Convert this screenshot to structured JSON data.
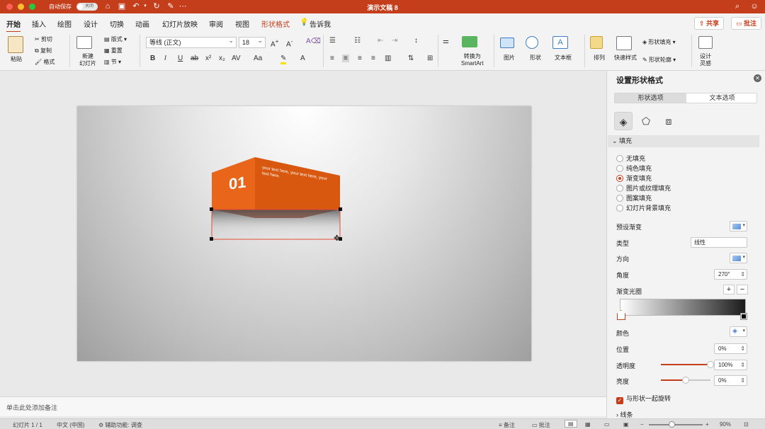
{
  "app": {
    "autosave_label": "自动保存",
    "autosave_state": "关闭",
    "doc_title": "演示文稿 8"
  },
  "tabs": [
    {
      "label": "开始"
    },
    {
      "label": "插入"
    },
    {
      "label": "绘图"
    },
    {
      "label": "设计"
    },
    {
      "label": "切换"
    },
    {
      "label": "动画"
    },
    {
      "label": "幻灯片放映"
    },
    {
      "label": "审阅"
    },
    {
      "label": "视图"
    },
    {
      "label": "形状格式"
    },
    {
      "label": "告诉我"
    }
  ],
  "header_buttons": {
    "share": "共享",
    "comments": "批注"
  },
  "ribbon": {
    "paste": "粘贴",
    "cut": "剪切",
    "copy": "复制",
    "format_painter": "格式",
    "new_slide": "新建\n幻灯片",
    "layout": "版式",
    "reset": "重置",
    "section": "节",
    "font_name": "等线 (正文)",
    "font_size": "18",
    "convert_smartart": "转换为\nSmartArt",
    "picture": "图片",
    "shape": "形状",
    "textbox": "文本框",
    "arrange": "排列",
    "quick_styles": "快速样式",
    "shape_fill": "形状填充",
    "shape_outline": "形状轮廓",
    "design_ideas": "设计\n灵感"
  },
  "slide": {
    "number": "01",
    "body": "your text here, your text here, your text here."
  },
  "notes_placeholder": "单击此处添加备注",
  "status": {
    "slide_count": "幻灯片 1 / 1",
    "language": "中文 (中国)",
    "accessibility": "辅助功能: 调查",
    "notes": "备注",
    "comments": "批注",
    "zoom": "90%"
  },
  "pane": {
    "title": "设置形状格式",
    "tab_shape": "形状选项",
    "tab_text": "文本选项",
    "fill_section": "填充",
    "fill_options": [
      "无填充",
      "纯色填充",
      "渐变填充",
      "图片或纹理填充",
      "图案填充",
      "幻灯片背景填充"
    ],
    "selected_fill": "渐变填充",
    "preset_label": "预设渐变",
    "type_label": "类型",
    "type_value": "线性",
    "direction_label": "方向",
    "angle_label": "角度",
    "angle_value": "270°",
    "stops_label": "渐变光圈",
    "color_label": "颜色",
    "position_label": "位置",
    "position_value": "0%",
    "transparency_label": "透明度",
    "transparency_value": "100%",
    "transparency_level": 1.0,
    "brightness_label": "亮度",
    "brightness_value": "0%",
    "brightness_level": 0.5,
    "rotate_with_shape": "与形状一起旋转",
    "line_section": "线条"
  },
  "colors": {
    "accent": "#c43e1c",
    "shape_orange": "#e8651a",
    "selection": "#e74c3c"
  }
}
